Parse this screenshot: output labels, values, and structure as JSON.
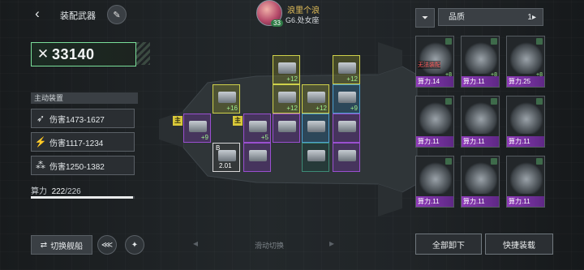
{
  "header": {
    "back_icon": "chevron-left-icon",
    "title": "装配武器",
    "edit_icon": "pencil-icon"
  },
  "player": {
    "name": "浪里个浪",
    "level": "33",
    "info": "G6.处女座"
  },
  "power": {
    "icon": "crossed-swords-icon",
    "value": "33140"
  },
  "active_equipment": {
    "header": "主动装置",
    "slots": [
      {
        "icon": "missile-icon",
        "label": "伤害1473-1627"
      },
      {
        "icon": "laser-icon",
        "label": "伤害1117-1234"
      },
      {
        "icon": "cannon-icon",
        "label": "伤害1250-1382"
      }
    ]
  },
  "capacity": {
    "label": "算力",
    "current": "222",
    "max": "/226",
    "fill_fraction": 0.982
  },
  "footer": {
    "switch_ship": "切换舰船",
    "swipe_hint": "滑动切换",
    "tool_icon_1": "fleet-icon",
    "tool_icon_2": "compass-icon"
  },
  "ship_grid": {
    "cells": [
      {
        "color": "y",
        "plus": "+12",
        "main": false
      },
      {
        "color": "y",
        "plus": "+12",
        "main": false
      },
      {
        "color": "y",
        "plus": "+16",
        "main": false
      },
      {
        "color": "y",
        "plus": "+12",
        "main": false
      },
      {
        "color": "y",
        "plus": "+12",
        "main": false
      },
      {
        "color": "b",
        "plus": "+9",
        "main": false
      },
      {
        "color": "p",
        "plus": "+9",
        "main": true
      },
      {
        "color": "p",
        "plus": "+5",
        "main": true
      },
      {
        "color": "p",
        "plus": "",
        "main": false
      },
      {
        "color": "b",
        "plus": "",
        "main": false
      },
      {
        "color": "p",
        "plus": "",
        "main": false
      },
      {
        "color": "w",
        "plus": "",
        "main": false,
        "number": "2.01",
        "badge": "B"
      },
      {
        "color": "p",
        "plus": "",
        "main": false
      },
      {
        "color": "g",
        "plus": "",
        "main": false
      },
      {
        "color": "p",
        "plus": "",
        "main": false
      }
    ],
    "main_label": "主"
  },
  "inventory": {
    "filter_icon": "filter-icon",
    "sort_label": "品质",
    "sort_icon": "sort-icon",
    "cards": [
      {
        "cost": "算力.14",
        "rarity": "p",
        "warning": "无法装配",
        "plus": "+8"
      },
      {
        "cost": "算力.11",
        "rarity": "p",
        "plus": "+8"
      },
      {
        "cost": "算力.25",
        "rarity": "p",
        "plus": "+8"
      },
      {
        "cost": "算力.11",
        "rarity": "p"
      },
      {
        "cost": "算力.11",
        "rarity": "p"
      },
      {
        "cost": "算力.11",
        "rarity": "p"
      },
      {
        "cost": "算力.11",
        "rarity": "p"
      },
      {
        "cost": "算力.11",
        "rarity": "p"
      },
      {
        "cost": "算力.11",
        "rarity": "p"
      }
    ],
    "unequip_all": "全部卸下",
    "quick_equip": "快捷装载"
  }
}
